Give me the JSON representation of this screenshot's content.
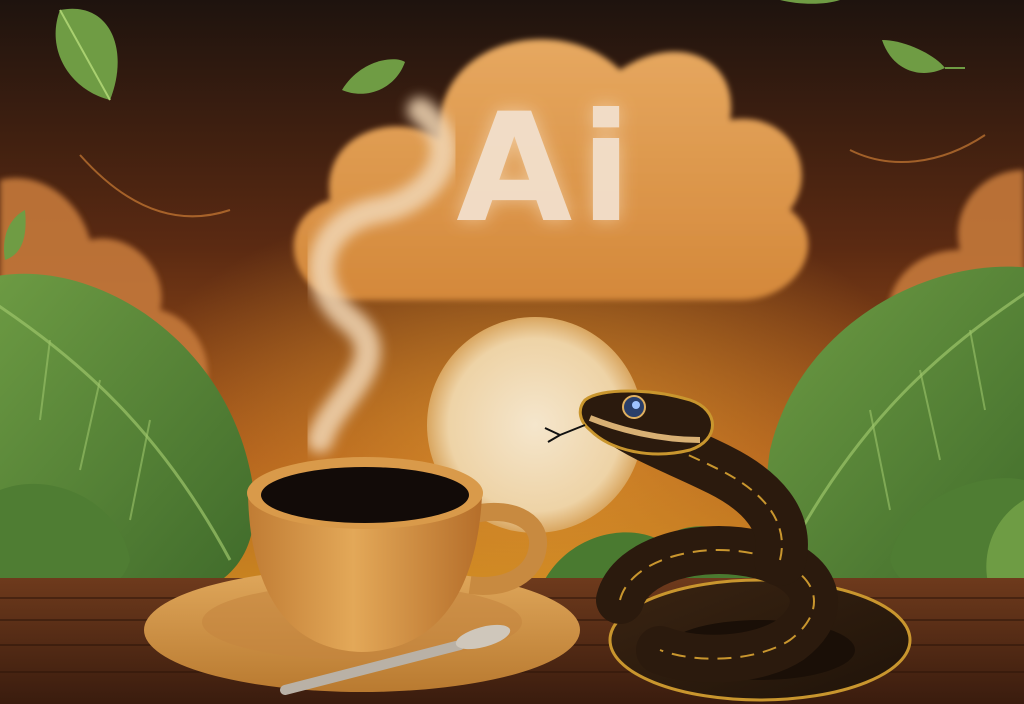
{
  "scene": {
    "cloud_text": "Ai",
    "subjects": [
      "coffee-cup",
      "saucer",
      "spoon",
      "snake",
      "sun",
      "cloud",
      "leaves",
      "steam",
      "wooden-table"
    ],
    "colors": {
      "sky_top": "#1e130e",
      "sky_mid": "#7a3a14",
      "sky_glow": "#c9861f",
      "cloud": "#e0a45a",
      "sun": "#f0dcc0",
      "leaf": "#5b8a3a",
      "table": "#5a2e18",
      "cup": "#d99a4a",
      "coffee": "#120b08",
      "snake_body": "#2b1a0d",
      "snake_pattern": "#c9962e"
    }
  }
}
